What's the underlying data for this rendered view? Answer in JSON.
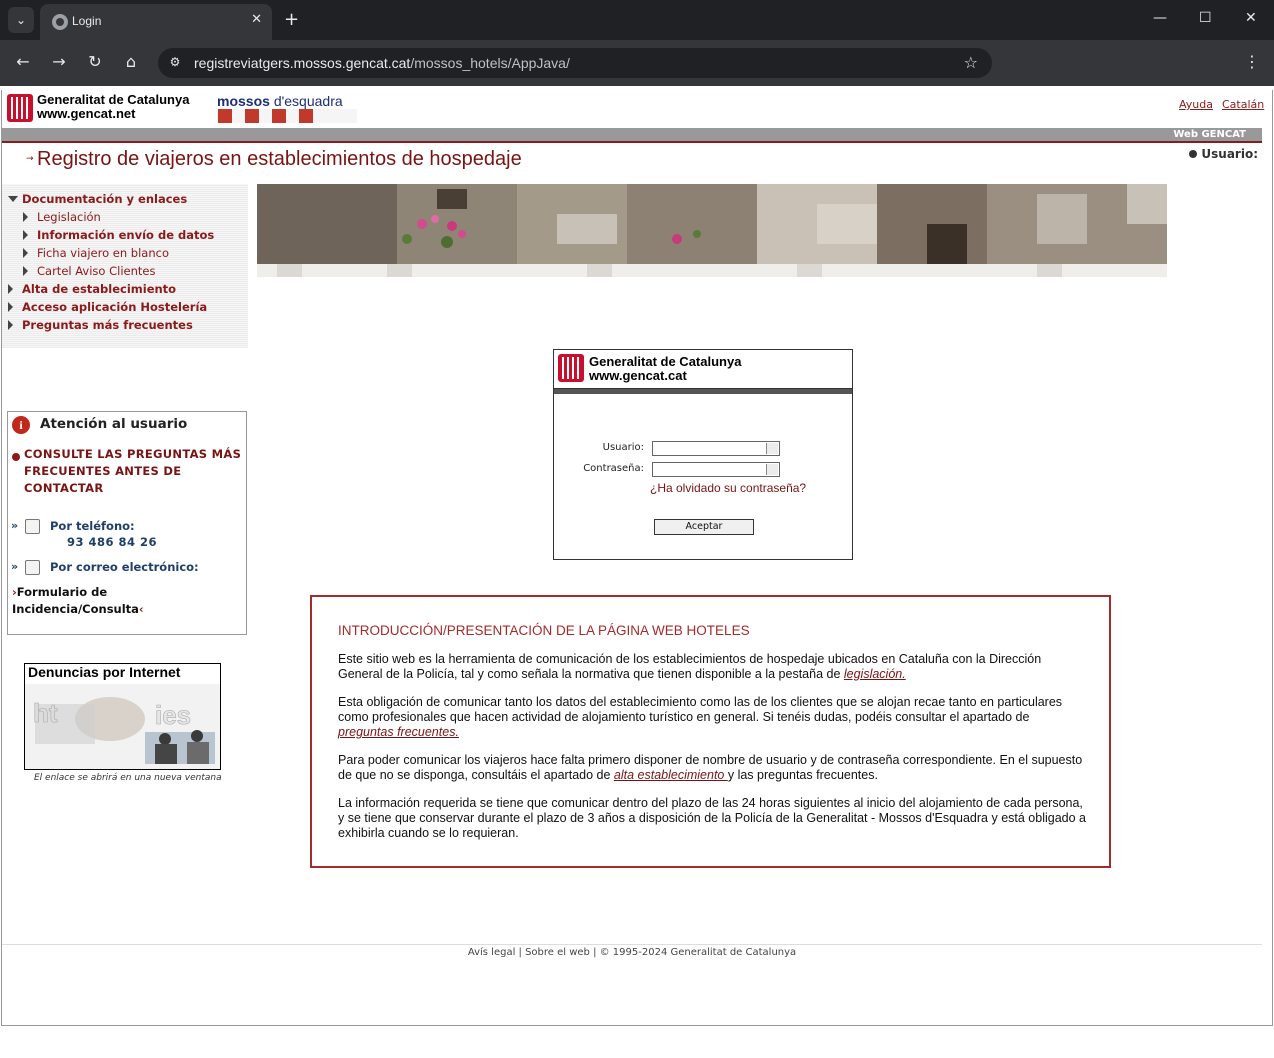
{
  "browser": {
    "tab_title": "Login",
    "url_host": "registreviatgers.mossos.gencat.cat",
    "url_path": "/mossos_hotels/AppJava/"
  },
  "header": {
    "gencat_line1": "Generalitat de Catalunya",
    "gencat_line2": "www.gencat.net",
    "mossos_part1": "mossos",
    "mossos_part2": "d'esquadra",
    "link_ayuda": "Ayuda",
    "link_catalan": "Catalán",
    "bar_label": "Web GENCAT",
    "site_title": "Registro de viajeros en establecimientos de hospedaje",
    "usuario_label": "Usuario:"
  },
  "sidebar": {
    "menu": [
      {
        "label": "Documentación y enlaces",
        "style": "bold",
        "expanded": true
      },
      {
        "label": "Legislación",
        "style": "normal"
      },
      {
        "label": "Información envío de datos",
        "style": "bold"
      },
      {
        "label": "Ficha viajero en blanco",
        "style": "normal"
      },
      {
        "label": "Cartel Aviso Clientes",
        "style": "normal"
      },
      {
        "label": "Alta de establecimiento",
        "style": "bold"
      },
      {
        "label": "Acceso aplicación Hostelería",
        "style": "bold"
      },
      {
        "label": "Preguntas más frecuentes",
        "style": "bold"
      }
    ],
    "atencion": {
      "title": "Atención al usuario",
      "consulte": "CONSULTE LAS PREGUNTAS MÁS FRECUENTES ANTES DE CONTACTAR",
      "phone_label": "Por teléfono:",
      "phone_number": "93 486 84 26",
      "email_label": "Por correo electrónico:",
      "formulario": "Formulario de Incidencia/Consulta"
    },
    "denuncias": {
      "title": "Denuncias por Internet",
      "note": "El enlace se abrirá en una nueva ventana"
    }
  },
  "login": {
    "logo_line1": "Generalitat de Catalunya",
    "logo_line2": "www.gencat.cat",
    "user_label": "Usuario:",
    "password_label": "Contraseña:",
    "forgot": "¿Ha olvidado su contraseña?",
    "submit": "Aceptar"
  },
  "intro": {
    "title": "INTRODUCCIÓN/PRESENTACIÓN DE LA PÁGINA WEB HOTELES",
    "p1_text": "Este sitio web es la herramienta de comunicación de los establecimientos de hospedaje ubicados en Cataluña con la Dirección General de la Policía, tal y como señala la normativa que tienen disponible a la pestaña de ",
    "p1_link": "legislación.",
    "p2_text": "Esta obligación de comunicar tanto los datos del establecimiento como las de los clientes que se alojan recae tanto en particulares como profesionales que hacen actividad de alojamiento turístico en general. Si tenéis dudas, podéis consultar el apartado de ",
    "p2_link": "preguntas frecuentes.",
    "p3_text": "Para poder comunicar los viajeros hace falta primero disponer de nombre de usuario y de contraseña correspondiente. En el supuesto de que no se disponga, consultáis el apartado de ",
    "p3_link": "alta establecimiento ",
    "p3_tail": "y las preguntas frecuentes.",
    "p4_text": "La información requerida se tiene que comunicar dentro del plazo de las 24 horas siguientes al inicio del alojamiento de cada persona, y se tiene que conservar durante el plazo de 3 años a disposición de la Policía de la Generalitat - Mossos d'Esquadra y está obligado a exhibirla cuando se lo requieran."
  },
  "footer": {
    "text": "Avís legal | Sobre el web | © 1995-2024 Generalitat de Catalunya"
  },
  "colors": {
    "brand_red": "#8b1a1a",
    "accent_blue": "#1f3f6a"
  }
}
